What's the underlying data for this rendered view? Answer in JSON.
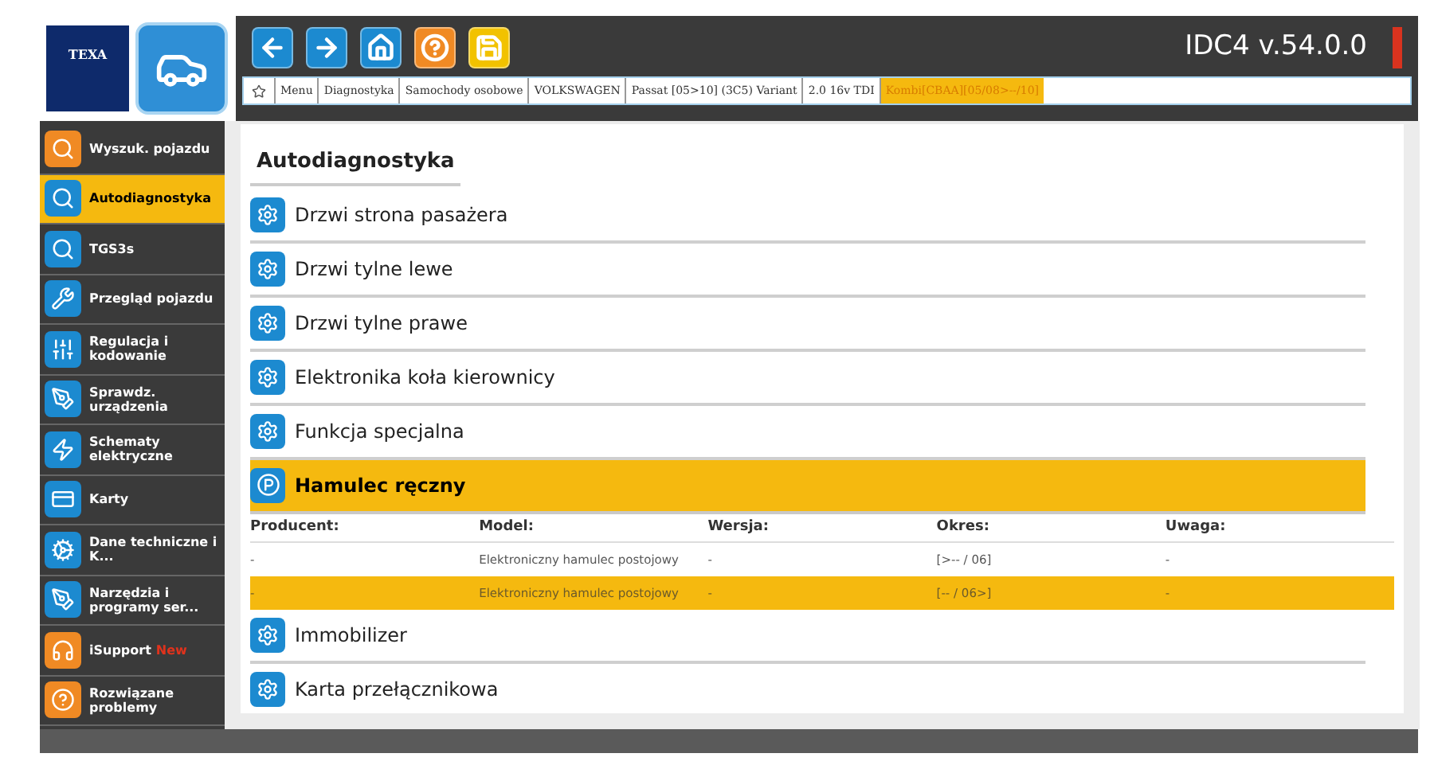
{
  "logo": {
    "text": "TEXA"
  },
  "header": {
    "version": "IDC4 v.54.0.0"
  },
  "breadcrumb": [
    {
      "label": "Menu",
      "selected": false
    },
    {
      "label": "Diagnostyka",
      "selected": false
    },
    {
      "label": "Samochody osobowe",
      "selected": false
    },
    {
      "label": "VOLKSWAGEN",
      "selected": false
    },
    {
      "label": "Passat [05>10] (3C5) Variant",
      "selected": false
    },
    {
      "label": "2.0 16v TDI",
      "selected": false
    },
    {
      "label": "Kombi[CBAA][05/08>--/10]",
      "selected": true
    }
  ],
  "sidebar": {
    "items": [
      {
        "label": "Wyszuk. pojazdu",
        "kind": "orange",
        "selected": false
      },
      {
        "label": "Autodiagnostyka",
        "kind": "blue",
        "selected": true
      },
      {
        "label": "TGS3s",
        "kind": "blue",
        "selected": false
      },
      {
        "label": "Przegląd pojazdu",
        "kind": "blue",
        "selected": false
      },
      {
        "label": "Regulacja i kodowanie",
        "kind": "blue",
        "selected": false
      },
      {
        "label": "Sprawdz. urządzenia",
        "kind": "blue",
        "selected": false
      },
      {
        "label": "Schematy elektryczne",
        "kind": "blue",
        "selected": false
      },
      {
        "label": "Karty",
        "kind": "blue",
        "selected": false
      },
      {
        "label": "Dane techniczne i K...",
        "kind": "blue",
        "selected": false
      },
      {
        "label": "Narzędzia i programy ser...",
        "kind": "blue",
        "selected": false
      },
      {
        "label": "iSupport",
        "badge": "New",
        "kind": "orange",
        "selected": false
      },
      {
        "label": "Rozwiązane problemy",
        "kind": "orange",
        "selected": false
      }
    ]
  },
  "content": {
    "tab": "Autodiagnostyka",
    "items": [
      {
        "label": "Drzwi strona pasażera",
        "expanded": false
      },
      {
        "label": "Drzwi tylne lewe",
        "expanded": false
      },
      {
        "label": "Drzwi tylne prawe",
        "expanded": false
      },
      {
        "label": "Elektronika koła kierownicy",
        "expanded": false
      },
      {
        "label": "Funkcja specjalna",
        "expanded": false
      },
      {
        "label": "Hamulec ręczny",
        "expanded": true,
        "table": {
          "columns": [
            "Producent:",
            "Model:",
            "Wersja:",
            "Okres:",
            "Uwaga:"
          ],
          "rows": [
            {
              "cells": [
                "-",
                "Elektroniczny hamulec postojowy",
                "-",
                "[>-- / 06]",
                "-"
              ],
              "selected": false
            },
            {
              "cells": [
                "-",
                "Elektroniczny hamulec postojowy",
                "-",
                "[-- / 06>]",
                "-"
              ],
              "selected": true
            }
          ]
        }
      },
      {
        "label": "Immobilizer",
        "expanded": false
      },
      {
        "label": "Karta przełącznikowa",
        "expanded": false
      }
    ]
  }
}
